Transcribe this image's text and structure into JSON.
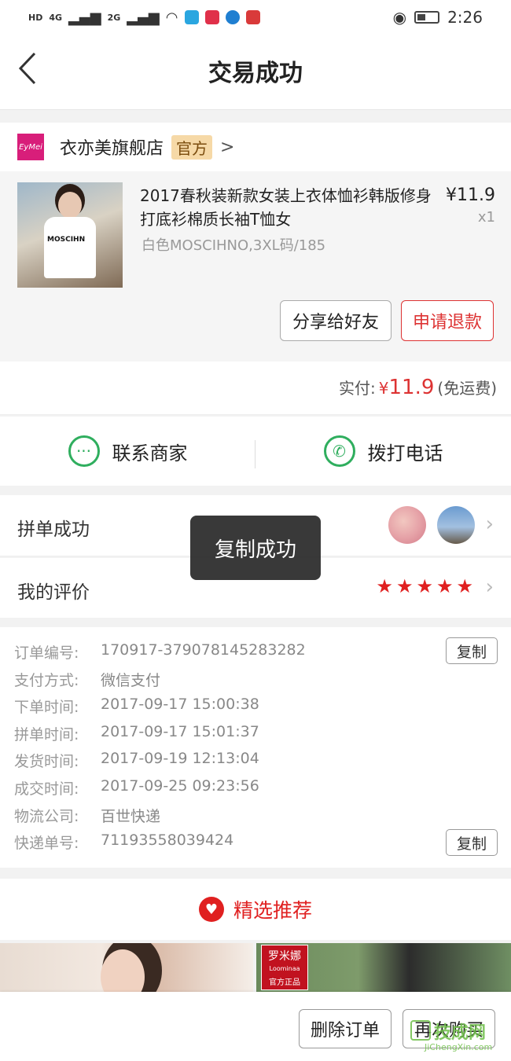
{
  "status_bar": {
    "network_left": "HD",
    "signal_1": "4G",
    "signal_2": "2G",
    "time": "2:26"
  },
  "nav": {
    "title": "交易成功"
  },
  "store": {
    "logo_text": "EyMei",
    "name": "衣亦美旗舰店",
    "badge": "官方",
    "arrow": ">"
  },
  "product": {
    "title": "2017春秋装新款女装上衣体恤衫韩版修身打底衫棉质长袖T恤女",
    "spec": "白色MOSCIHNO,3XL码/185",
    "price": "¥11.9",
    "qty": "x1",
    "shirt_logo": "MOSCIHN"
  },
  "actions": {
    "share": "分享给好友",
    "refund": "申请退款"
  },
  "payment": {
    "label": "实付:",
    "currency": "¥",
    "amount": "11.9",
    "note": "(免运费)"
  },
  "contact": {
    "merchant": "联系商家",
    "phone": "拨打电话"
  },
  "group": {
    "label": "拼单成功"
  },
  "review": {
    "label": "我的评价",
    "rating": 5
  },
  "toast": "复制成功",
  "order_details": [
    {
      "key": "订单编号:",
      "value": "170917-379078145283282"
    },
    {
      "key": "支付方式:",
      "value": "微信支付"
    },
    {
      "key": "下单时间:",
      "value": "2017-09-17 15:00:38"
    },
    {
      "key": "拼单时间:",
      "value": "2017-09-17 15:01:37"
    },
    {
      "key": "发货时间:",
      "value": "2017-09-19 12:13:04"
    },
    {
      "key": "成交时间:",
      "value": "2017-09-25 09:23:56"
    },
    {
      "key": "物流公司:",
      "value": "百世快递"
    },
    {
      "key": "快递单号:",
      "value": "71193558039424"
    }
  ],
  "copy_label": "复制",
  "recommend": {
    "title": "精选推荐",
    "brand_tag": "罗米娜",
    "brand_sub": "Loominaa",
    "brand_sub2": "官方正品"
  },
  "bottom": {
    "delete": "删除订单",
    "rebuy": "再次购买"
  },
  "watermark": {
    "main": "技成网",
    "sub": "JiChengXin.com"
  },
  "colors": {
    "accent_red": "#e02020",
    "green": "#2fae5e",
    "badge_bg": "#f6d9a7"
  }
}
